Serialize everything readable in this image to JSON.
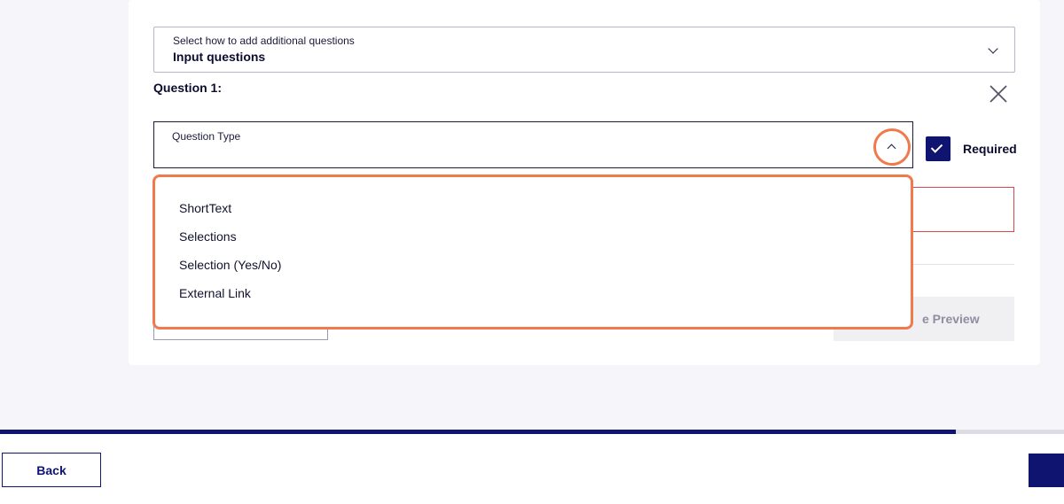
{
  "form": {
    "add_questions_select": {
      "label": "Select how to add additional questions",
      "value": "Input questions"
    },
    "question_title": "Question 1:",
    "question_type": {
      "label": "Question Type",
      "options": [
        "ShortText",
        "Selections",
        "Selection (Yes/No)",
        "External Link"
      ]
    },
    "required_label": "Required",
    "preview_label": "e Preview"
  },
  "progress": {
    "fraction": 0.898
  },
  "footer": {
    "back_label": "Back"
  },
  "colors": {
    "accent": "#0e1470",
    "highlight": "#f07a4c",
    "error": "#d44a4a"
  }
}
